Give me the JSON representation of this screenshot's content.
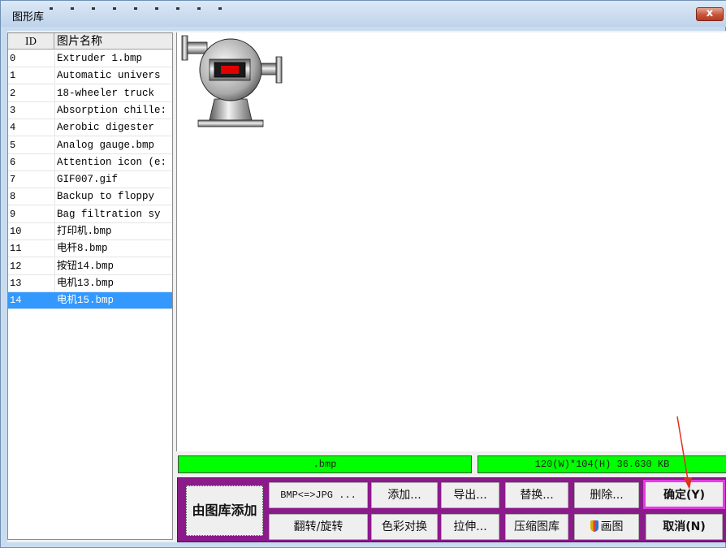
{
  "window": {
    "title": "图形库",
    "close_label": "x"
  },
  "list": {
    "col_id": "ID",
    "col_name": "图片名称",
    "rows": [
      {
        "id": "0",
        "name": "Extruder 1.bmp"
      },
      {
        "id": "1",
        "name": "Automatic univers"
      },
      {
        "id": "2",
        "name": "18-wheeler truck"
      },
      {
        "id": "3",
        "name": "Absorption chille:"
      },
      {
        "id": "4",
        "name": "Aerobic digester"
      },
      {
        "id": "5",
        "name": "Analog gauge.bmp"
      },
      {
        "id": "6",
        "name": "Attention icon (e:"
      },
      {
        "id": "7",
        "name": "GIF007.gif"
      },
      {
        "id": "8",
        "name": "Backup to floppy"
      },
      {
        "id": "9",
        "name": "Bag filtration sy"
      },
      {
        "id": "10",
        "name": "打印机.bmp"
      },
      {
        "id": "11",
        "name": "电杆8.bmp"
      },
      {
        "id": "12",
        "name": "按钮14.bmp"
      },
      {
        "id": "13",
        "name": "电机13.bmp"
      },
      {
        "id": "14",
        "name": "电机15.bmp"
      }
    ],
    "selected_id": "14"
  },
  "preview": {
    "image_icon": "motor-pump-icon"
  },
  "status": {
    "filename": ".bmp",
    "dimensions": "120(W)*104(H)   36.630 KB"
  },
  "buttons": {
    "add_from_library": "由图库添加",
    "bmp_jpg": "BMP<=>JPG ...",
    "add": "添加...",
    "export": "导出...",
    "replace": "替换...",
    "delete": "删除...",
    "confirm": "确定(Y)",
    "flip_rotate": "翻转/旋转",
    "color_swap": "色彩对换",
    "stretch": "拉伸...",
    "compress": "压缩图库",
    "paint": "画图",
    "cancel": "取消(N)"
  },
  "colors": {
    "status_bg": "#00ff00",
    "panel_bg": "#8b1a8b",
    "selection": "#3399ff",
    "highlight_outline": "#e43be4",
    "annotation_arrow": "#e03020"
  }
}
